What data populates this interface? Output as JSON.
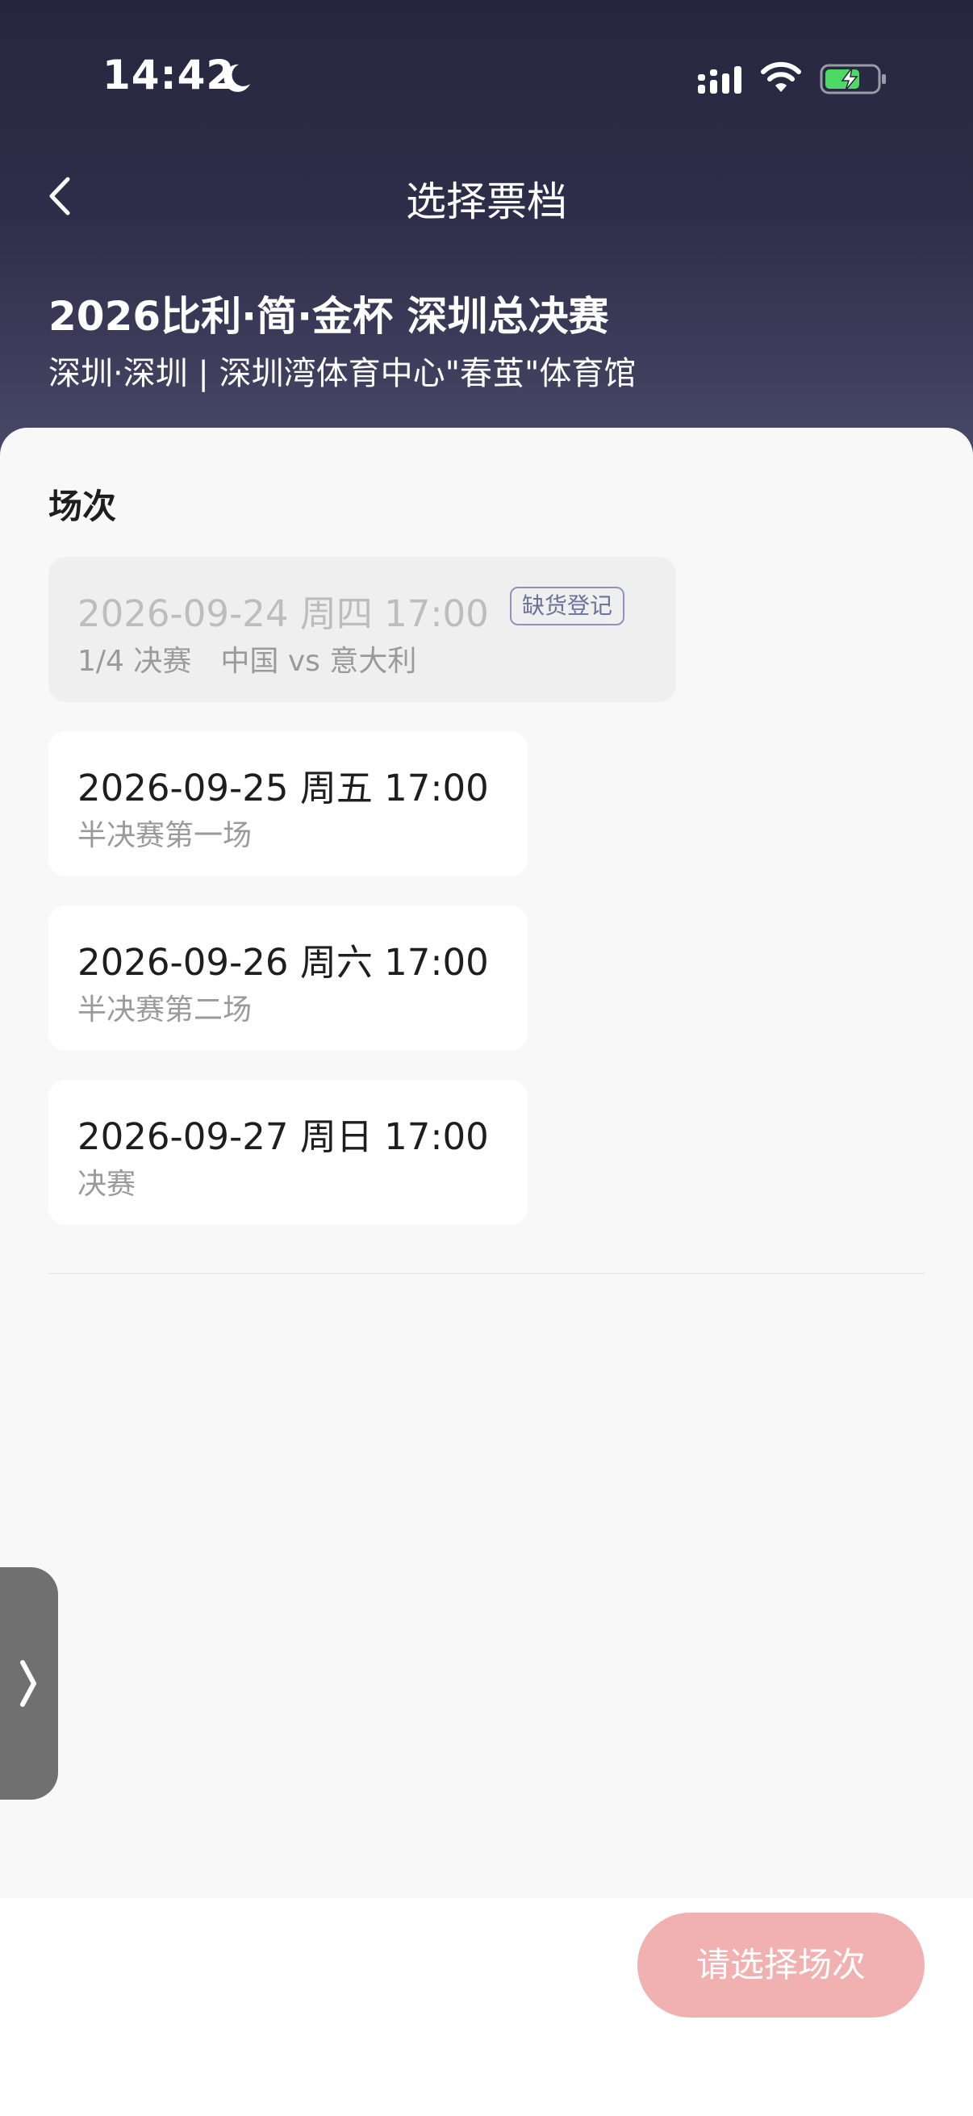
{
  "status_bar": {
    "time": "14:42",
    "moon_icon": "moon-icon",
    "signal_icon": "signal-icon",
    "wifi_icon": "wifi-icon",
    "battery_icon": "battery-charging-icon"
  },
  "header": {
    "back_icon": "chevron-left-icon",
    "title": "选择票档",
    "event_title": "2026比利·简·金杯 深圳总决赛",
    "event_venue": "深圳·深圳 | 深圳湾体育中心\"春茧\"体育馆"
  },
  "sessions_section": {
    "title": "场次",
    "sessions": [
      {
        "date": "2026-09-24 周四 17:00",
        "desc": "1/4 决赛　中国 vs 意大利",
        "badge": "缺货登记",
        "sold_out": true
      },
      {
        "date": "2026-09-25 周五 17:00",
        "desc": "半决赛第一场",
        "sold_out": false
      },
      {
        "date": "2026-09-26 周六 17:00",
        "desc": "半决赛第二场",
        "sold_out": false
      },
      {
        "date": "2026-09-27 周日 17:00",
        "desc": "决赛",
        "sold_out": false
      }
    ]
  },
  "side_tab": {
    "icon": "chevron-right-icon"
  },
  "footer": {
    "confirm_label": "请选择场次"
  },
  "colors": {
    "header_top": "#26263e",
    "header_bottom": "#4a4a6a",
    "button_disabled": "#f2b1b1",
    "badge_border": "#8d94b8"
  }
}
